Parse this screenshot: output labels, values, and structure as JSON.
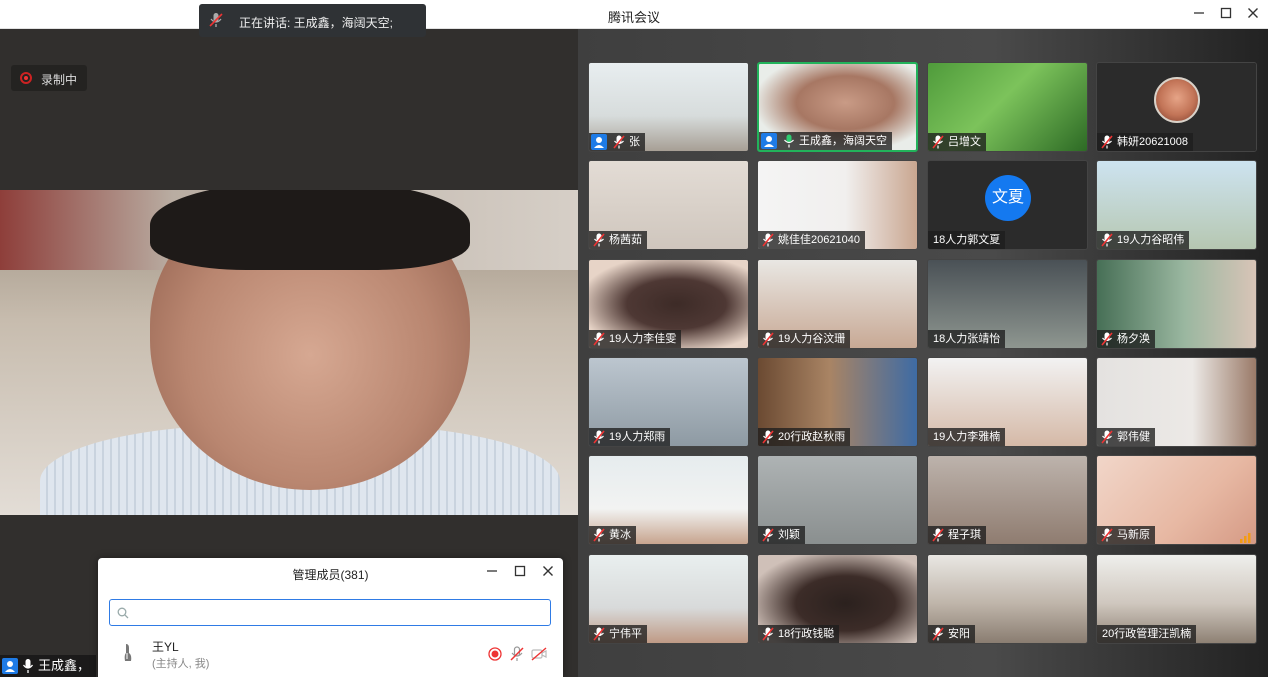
{
  "window": {
    "title": "腾讯会议"
  },
  "speaking": {
    "text": "正在讲话: 王成鑫，海阔天空;"
  },
  "recording": {
    "label": "录制中"
  },
  "main": {
    "name": "王成鑫，"
  },
  "panel": {
    "title": "管理成员(381)",
    "search_placeholder": "",
    "member": {
      "name": "王YL",
      "role": "(主持人, 我)"
    }
  },
  "tiles": [
    {
      "name": "张",
      "host": true,
      "mic": "muted",
      "bg": "linear-gradient(180deg,#e8eef0 0%,#d7dcdc 60%,#a79f95 100%)"
    },
    {
      "name": "王成鑫，海阔天空",
      "host": true,
      "mic": "on",
      "active": true,
      "bg": "radial-gradient(ellipse at 55% 45%,#c99b86 0%,#a77763 40%,#e9ede9 75%)"
    },
    {
      "name": "吕增文",
      "mic": "muted",
      "bg": "linear-gradient(135deg,#4f9b3b 0%,#7cc35b 45%,#2d6a25 100%)"
    },
    {
      "name": "韩妍20621008",
      "mic": "muted",
      "bg": "#2b2b2b",
      "circle": true
    },
    {
      "name": "杨茜茹",
      "mic": "muted",
      "bg": "linear-gradient(180deg,#e3dcd5 0%,#cfc6bd 100%)"
    },
    {
      "name": "姚佳佳20621040",
      "mic": "muted",
      "bg": "linear-gradient(90deg,#f4f4f4 0%,#f1efee 55%,#c9a690 100%)"
    },
    {
      "name": "18人力郭文夏",
      "mic": "none",
      "bg": "#2b2b2b",
      "avatar": "文夏"
    },
    {
      "name": "19人力谷昭伟",
      "mic": "muted",
      "bg": "linear-gradient(180deg,#cde3f0 0%,#b6c7b1 100%)"
    },
    {
      "name": "19人力李佳雯",
      "mic": "muted",
      "bg": "radial-gradient(ellipse at 55% 50%,#3d2b27 0%,#4e3834 40%,#e7d4c7 80%)"
    },
    {
      "name": "19人力谷汶珊",
      "mic": "muted",
      "bg": "linear-gradient(180deg,#e9e7e3 0%,#c8a995 100%)"
    },
    {
      "name": "18人力张靖怡",
      "mic": "none",
      "bg": "linear-gradient(180deg,#4a5156 0%,#8e9690 100%)"
    },
    {
      "name": "杨夕涣",
      "mic": "muted",
      "bg": "linear-gradient(90deg,#476f56 0%,#9ab7a0 55%,#d8c4b7 100%)"
    },
    {
      "name": "19人力郑雨",
      "mic": "muted",
      "bg": "linear-gradient(180deg,#bcc6cf 0%,#8e9aa3 100%)"
    },
    {
      "name": "20行政赵秋雨",
      "mic": "muted",
      "bg": "linear-gradient(90deg,#6b4a32 0%,#a98464 45%,#3e6ba4 100%)"
    },
    {
      "name": "19人力李雅楠",
      "mic": "none",
      "bg": "linear-gradient(180deg,#f2f2f2 0%,#d5b9a7 100%)"
    },
    {
      "name": "郭伟健",
      "mic": "muted",
      "bg": "linear-gradient(90deg,#e4e2e0 0%,#ece9e6 60%,#9a7a68 100%)"
    },
    {
      "name": "黄冰",
      "mic": "muted",
      "bg": "linear-gradient(180deg,#e6ecee 0%,#f2f3f2 60%,#c7a48e 100%)"
    },
    {
      "name": "刘颖",
      "mic": "muted",
      "bg": "linear-gradient(180deg,#aeb3b4 0%,#8a8f8f 100%)"
    },
    {
      "name": "程子琪",
      "mic": "muted",
      "bg": "linear-gradient(180deg,#bdb3ac 0%,#8f7c70 100%)"
    },
    {
      "name": "马新原",
      "mic": "muted",
      "bg": "linear-gradient(135deg,#f1d6c9 0%,#e7b8a3 60%,#d59a85 100%)",
      "bars": true
    },
    {
      "name": "宁伟平",
      "mic": "muted",
      "bg": "linear-gradient(180deg,#e9efef 0%,#d8dada 60%,#bf9a85 100%)"
    },
    {
      "name": "18行政钱聪",
      "mic": "muted",
      "bg": "radial-gradient(ellipse at 55% 55%,#2b211e 0%,#3c2c28 40%,#cfc0b8 80%)"
    },
    {
      "name": "安阳",
      "mic": "muted",
      "bg": "linear-gradient(180deg,#e9e7e3 0%,#bfb5aa 55%,#8a7d71 100%)"
    },
    {
      "name": "20行政管理汪凯楠",
      "mic": "none",
      "bg": "linear-gradient(180deg,#efefec 0%,#cfc7be 55%,#8e8174 100%)"
    }
  ]
}
